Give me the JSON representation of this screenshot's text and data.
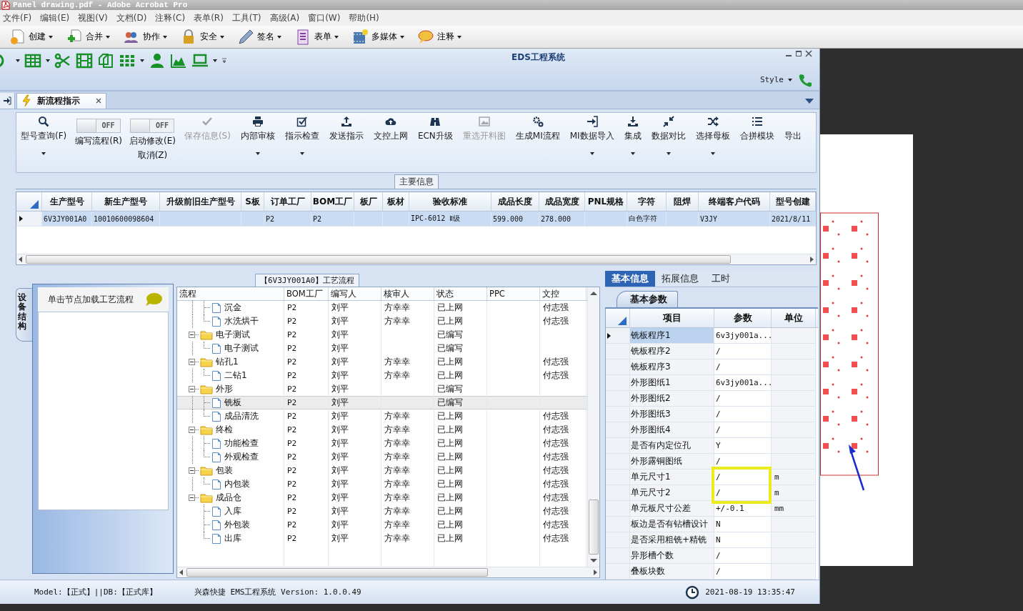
{
  "acrobat": {
    "title": "Panel drawing.pdf - Adobe Acrobat Pro",
    "menu": [
      "文件(F)",
      "编辑(E)",
      "视图(V)",
      "文档(D)",
      "注释(C)",
      "表单(R)",
      "工具(T)",
      "高级(A)",
      "窗口(W)",
      "帮助(H)"
    ],
    "toolbar": [
      "创建",
      "合并",
      "协作",
      "安全",
      "签名",
      "表单",
      "多媒体",
      "注释"
    ]
  },
  "ems": {
    "title": "EDS工程系统",
    "style_menu": "Style",
    "document_tab": {
      "label": "新流程指示",
      "selected": true
    },
    "ribbon": [
      {
        "kind": "button",
        "label": "型号查询(F)",
        "dropdown": true,
        "disabled": false
      },
      {
        "kind": "toggle",
        "switch": "OFF",
        "on": false,
        "label": "编写流程(R)"
      },
      {
        "kind": "toggle",
        "switch": "OFF",
        "on": false,
        "label": "启动修改(E)",
        "sublabel": "取消(Z)"
      },
      {
        "kind": "button",
        "label": "保存信息(S)",
        "dropdown": false,
        "disabled": true
      },
      {
        "kind": "button",
        "label": "内部审核",
        "dropdown": true,
        "disabled": false
      },
      {
        "kind": "button",
        "label": "指示检查",
        "dropdown": true,
        "disabled": false
      },
      {
        "kind": "button",
        "label": "发送指示",
        "dropdown": false,
        "disabled": false
      },
      {
        "kind": "button",
        "label": "文控上网",
        "dropdown": false,
        "disabled": false
      },
      {
        "kind": "button",
        "label": "ECN升级",
        "dropdown": false,
        "disabled": false
      },
      {
        "kind": "button",
        "label": "重选开料图",
        "dropdown": false,
        "disabled": true
      },
      {
        "kind": "button",
        "label": "生成MI流程",
        "dropdown": false,
        "disabled": false
      },
      {
        "kind": "button",
        "label": "MI数据导入",
        "dropdown": true,
        "disabled": false
      },
      {
        "kind": "button",
        "label": "集成",
        "dropdown": true,
        "disabled": false
      },
      {
        "kind": "button",
        "label": "数据对比",
        "dropdown": true,
        "disabled": false
      },
      {
        "kind": "button",
        "label": "选择母板",
        "dropdown": true,
        "disabled": false
      },
      {
        "kind": "button",
        "label": "合拼模块",
        "dropdown": false,
        "disabled": false
      },
      {
        "kind": "button",
        "label": "导出",
        "dropdown": false,
        "disabled": false
      }
    ],
    "main_info": {
      "title": "主要信息",
      "columns": [
        "生产型号",
        "新生产型号",
        "升级前旧生产型号",
        "S板",
        "订单工厂",
        "BOM工厂",
        "板厂",
        "板材",
        "验收标准",
        "成品长度",
        "成品宽度",
        "PNL规格",
        "字符",
        "阻焊",
        "终端客户代码",
        "型号创建"
      ],
      "rows": [
        {
          "selected": true,
          "cells": [
            "6V3JY001A0",
            "10010600098604",
            null,
            null,
            "P2",
            "P2",
            null,
            null,
            "IPC-6012 Ⅱ级",
            "599.000",
            "278.000",
            null,
            "白色字符",
            null,
            "V3JY",
            "2021/8/11"
          ]
        }
      ]
    },
    "side_tab": "设备结构",
    "hint": "单击节点加载工艺流程",
    "process": {
      "title": "【6V3JY001A0】工艺流程",
      "columns": [
        "流程",
        "BOM工厂",
        "编写人",
        "核审人",
        "状态",
        "PPC",
        "文控"
      ],
      "tree": [
        {
          "kind": "group",
          "children": [
            {
              "kind": "file",
              "label": "沉金",
              "bom": "P2",
              "writer": "刘平",
              "reviewer": "方幸幸",
              "status": "已上网",
              "doc": "付志强",
              "selected": false
            },
            {
              "kind": "file",
              "label": "水洗烘干",
              "bom": "P2",
              "writer": "刘平",
              "reviewer": "方幸幸",
              "status": "已上网",
              "doc": "付志强",
              "selected": false
            }
          ]
        },
        {
          "kind": "folder",
          "label": "电子测试",
          "bom": "P2",
          "writer": "刘平",
          "status": "已编写",
          "selected": false,
          "expanded": true,
          "children": [
            {
              "kind": "file",
              "label": "电子测试",
              "bom": "P2",
              "writer": "刘平",
              "status": "已编写",
              "selected": false
            }
          ]
        },
        {
          "kind": "folder",
          "label": "钻孔1",
          "bom": "P2",
          "writer": "刘平",
          "reviewer": "方幸幸",
          "status": "已上网",
          "doc": "付志强",
          "selected": false,
          "expanded": true,
          "children": [
            {
              "kind": "file",
              "label": "二钻1",
              "bom": "P2",
              "writer": "刘平",
              "reviewer": "方幸幸",
              "status": "已上网",
              "doc": "付志强",
              "selected": false
            }
          ]
        },
        {
          "kind": "folder",
          "label": "外形",
          "bom": "P2",
          "writer": "刘平",
          "status": "已编写",
          "selected": false,
          "expanded": true,
          "children": [
            {
              "kind": "file",
              "label": "铣板",
              "bom": "P2",
              "writer": "刘平",
              "status": "已编写",
              "selected": true
            },
            {
              "kind": "file",
              "label": "成品清洗",
              "bom": "P2",
              "writer": "刘平",
              "reviewer": "方幸幸",
              "status": "已上网",
              "doc": "付志强",
              "selected": false
            }
          ]
        },
        {
          "kind": "folder",
          "label": "终检",
          "bom": "P2",
          "writer": "刘平",
          "reviewer": "方幸幸",
          "status": "已上网",
          "doc": "付志强",
          "selected": false,
          "expanded": true,
          "children": [
            {
              "kind": "file",
              "label": "功能检查",
              "bom": "P2",
              "writer": "刘平",
              "reviewer": "方幸幸",
              "status": "已上网",
              "doc": "付志强",
              "selected": false
            },
            {
              "kind": "file",
              "label": "外观检查",
              "bom": "P2",
              "writer": "刘平",
              "reviewer": "方幸幸",
              "status": "已上网",
              "doc": "付志强",
              "selected": false
            }
          ]
        },
        {
          "kind": "folder",
          "label": "包装",
          "bom": "P2",
          "writer": "刘平",
          "reviewer": "方幸幸",
          "status": "已上网",
          "doc": "付志强",
          "selected": false,
          "expanded": true,
          "children": [
            {
              "kind": "file",
              "label": "内包装",
              "bom": "P2",
              "writer": "刘平",
              "reviewer": "方幸幸",
              "status": "已上网",
              "doc": "付志强",
              "selected": false
            }
          ]
        },
        {
          "kind": "folder",
          "label": "成品仓",
          "bom": "P2",
          "writer": "刘平",
          "reviewer": "方幸幸",
          "status": "已上网",
          "doc": "付志强",
          "selected": false,
          "expanded": true,
          "children": [
            {
              "kind": "file",
              "label": "入库",
              "bom": "P2",
              "writer": "刘平",
              "reviewer": "方幸幸",
              "status": "已上网",
              "doc": "付志强",
              "selected": false
            },
            {
              "kind": "file",
              "label": "外包装",
              "bom": "P2",
              "writer": "刘平",
              "reviewer": "方幸幸",
              "status": "已上网",
              "doc": "付志强",
              "selected": false
            },
            {
              "kind": "file",
              "label": "出库",
              "bom": "P2",
              "writer": "刘平",
              "reviewer": "方幸幸",
              "status": "已上网",
              "doc": "付志强",
              "selected": false
            }
          ]
        }
      ]
    },
    "detail": {
      "tabs": [
        {
          "label": "基本信息",
          "selected": true
        },
        {
          "label": "拓展信息",
          "selected": false
        },
        {
          "label": "工时",
          "selected": false
        }
      ],
      "subtab": "基本参数",
      "columns": [
        "项目",
        "参数",
        "单位"
      ],
      "rows": [
        {
          "item": "铣板程序1",
          "value": "6v3jy001a...",
          "selected": true
        },
        {
          "item": "铣板程序2",
          "value": "/",
          "selected": false
        },
        {
          "item": "铣板程序3",
          "value": "/",
          "selected": false
        },
        {
          "item": "外形图纸1",
          "value": "6v3jy001a...",
          "selected": false
        },
        {
          "item": "外形图纸2",
          "value": "/",
          "selected": false
        },
        {
          "item": "外形图纸3",
          "value": "/",
          "selected": false
        },
        {
          "item": "外形图纸4",
          "value": "/",
          "selected": false
        },
        {
          "item": "是否有内定位孔",
          "value": "Y",
          "selected": false
        },
        {
          "item": "外形露铜图纸",
          "value": "/",
          "selected": false
        },
        {
          "item": "单元尺寸1",
          "value": "/",
          "unit": "m",
          "selected": false,
          "highlighted": true
        },
        {
          "item": "单元尺寸2",
          "value": "/",
          "unit": "m",
          "selected": false,
          "highlighted": true
        },
        {
          "item": "单元板尺寸公差",
          "value": "+/-0.1",
          "unit": "mm",
          "selected": false
        },
        {
          "item": "板边是否有钻槽设计",
          "value": "N",
          "selected": false
        },
        {
          "item": "是否采用粗铣+精铣",
          "value": "N",
          "selected": false
        },
        {
          "item": "异形槽个数",
          "value": "/",
          "selected": false
        },
        {
          "item": "叠板块数",
          "value": "/",
          "selected": false
        }
      ]
    },
    "status_bar": {
      "model": "Model:【正式】||DB:【正式库】",
      "version": "兴森快捷 EMS工程系统 Version: 1.0.0.49",
      "datetime": "2021-08-19 13:35:47"
    }
  }
}
